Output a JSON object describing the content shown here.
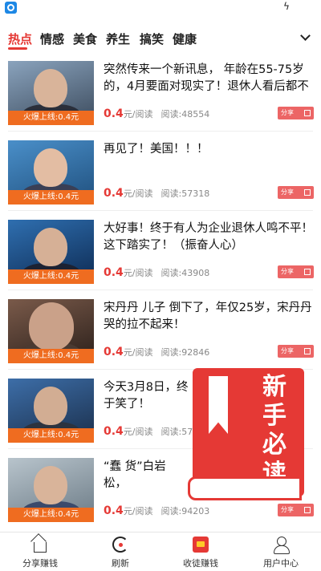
{
  "tabs": [
    "热点",
    "情感",
    "美食",
    "养生",
    "搞笑",
    "健康"
  ],
  "colors": {
    "accent": "#e53935",
    "banner": "#ef6c20",
    "share": "#ec6565"
  },
  "articles": [
    {
      "title": "突然传来一个新讯息， 年龄在55-75岁的，4月要面对现实了！退休人看后都不",
      "banner": "火爆上线:0.4元",
      "price": "0.4",
      "unit": "元/阅读",
      "reads": "阅读:48554",
      "share": "分享"
    },
    {
      "title": "再见了！美国！！！",
      "banner": "火爆上线:0.4元",
      "price": "0.4",
      "unit": "元/阅读",
      "reads": "阅读:57318",
      "share": "分享"
    },
    {
      "title": "大好事！终于有人为企业退休人鸣不平！这下踏实了！（振奋人心）",
      "banner": "火爆上线:0.4元",
      "price": "0.4",
      "unit": "元/阅读",
      "reads": "阅读:43908",
      "share": "分享"
    },
    {
      "title": "宋丹丹 儿子 倒下了，年仅25岁，宋丹丹哭的拉不起来！",
      "banner": "火爆上线:0.4元",
      "price": "0.4",
      "unit": "元/阅读",
      "reads": "阅读:92846",
      "share": "分享"
    },
    {
      "title": "  今天3月8日，终于笑了！",
      "banner": "火爆上线:0.4元",
      "price": "0.4",
      "unit": "元/阅读",
      "reads": "阅读:570",
      "share": "分享"
    },
    {
      "title": "“蠢 货”白岩松，",
      "banner": "火爆上线:0.4元",
      "price": "0.4",
      "unit": "元/阅读",
      "reads": "阅读:94203",
      "share": "分享"
    }
  ],
  "newbie_guide": "新手必读",
  "bottom_nav": [
    "分享赚钱",
    "刷新",
    "收徒赚钱",
    "用户中心"
  ]
}
